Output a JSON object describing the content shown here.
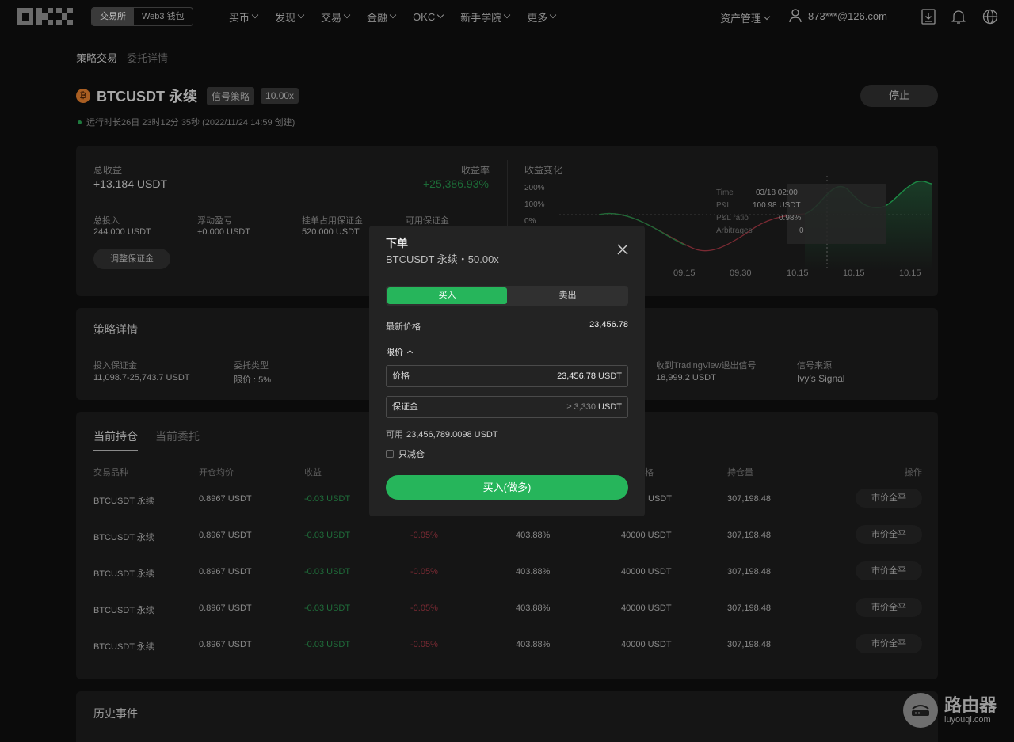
{
  "nav": {
    "logo": "OKX",
    "seg": [
      "交易所",
      "Web3 钱包"
    ],
    "menu": [
      "买币",
      "发现",
      "交易",
      "金融",
      "OKC",
      "新手学院",
      "更多"
    ],
    "asset": "资产管理",
    "user": "873***@126.com"
  },
  "breadcrumb": {
    "a": "策略交易",
    "b": "委托详情"
  },
  "title": {
    "coin": "₿",
    "pair": "BTCUSDT 永续",
    "tag1": "信号策略",
    "tag2": "10.00x",
    "runtime": "运行时长26日 23时12分 35秒 (2022/11/24 14:59 创建)",
    "stop": "停止"
  },
  "summary": {
    "total_label": "总收益",
    "total_value": "+13.184 USDT",
    "rate_label": "收益率",
    "rate_value": "+25,386.93%",
    "stats": [
      {
        "label": "总投入",
        "value": "244.000 USDT"
      },
      {
        "label": "浮动盈亏",
        "value": "+0.000 USDT"
      },
      {
        "label": "挂单占用保证金",
        "value": "520.000 USDT"
      },
      {
        "label": "可用保证金",
        "value": ""
      }
    ],
    "adjust": "调整保证金",
    "chart_title": "收益变化",
    "y_ticks": [
      "200%",
      "100%",
      "0%"
    ],
    "x_ticks": [
      "09.15",
      "09.30",
      "10.15",
      "10.15",
      "10.15"
    ],
    "tooltip": [
      {
        "k": "Time",
        "v": "03/18 02:00"
      },
      {
        "k": "P&L",
        "v": "100.98 USDT"
      },
      {
        "k": "P&L ratio",
        "v": "0.98%"
      },
      {
        "k": "Arbitrages",
        "v": "0"
      }
    ]
  },
  "details": {
    "title": "策略详情",
    "items": [
      {
        "label": "投入保证金",
        "value": "11,098.7-25,743.7 USDT"
      },
      {
        "label": "委托类型",
        "value": "限价 : 5%"
      },
      {
        "label": "收到TradingView退出信号",
        "value": "18,999.2 USDT"
      },
      {
        "label": "信号来源",
        "value": "Ivy’s Signal"
      }
    ]
  },
  "positions": {
    "tabs": [
      "当前持仓",
      "当前委托"
    ],
    "headers": [
      "交易品种",
      "开仓均价",
      "收益",
      "格",
      "持仓量",
      "操作"
    ],
    "rows": [
      {
        "pair": "BTCUSDT 永续",
        "avg": "0.8967 USDT",
        "pnl": "-0.03 USDT",
        "rate": "",
        "c5": "",
        "c6": "USDT",
        "qty": "307,198.48",
        "action": "市价全平"
      },
      {
        "pair": "BTCUSDT 永续",
        "avg": "0.8967 USDT",
        "pnl": "-0.03 USDT",
        "rate": "-0.05%",
        "c5": "403.88%",
        "c6": "40000 USDT",
        "qty": "307,198.48",
        "action": "市价全平"
      },
      {
        "pair": "BTCUSDT 永续",
        "avg": "0.8967 USDT",
        "pnl": "-0.03 USDT",
        "rate": "-0.05%",
        "c5": "403.88%",
        "c6": "40000 USDT",
        "qty": "307,198.48",
        "action": "市价全平"
      },
      {
        "pair": "BTCUSDT 永续",
        "avg": "0.8967 USDT",
        "pnl": "-0.03 USDT",
        "rate": "-0.05%",
        "c5": "403.88%",
        "c6": "40000 USDT",
        "qty": "307,198.48",
        "action": "市价全平"
      },
      {
        "pair": "BTCUSDT 永续",
        "avg": "0.8967 USDT",
        "pnl": "-0.03 USDT",
        "rate": "-0.05%",
        "c5": "403.88%",
        "c6": "40000 USDT",
        "qty": "307,198.48",
        "action": "市价全平"
      }
    ]
  },
  "history": {
    "title": "历史事件"
  },
  "modal": {
    "title": "下单",
    "subtitle": "BTCUSDT 永续・50.00x",
    "buy": "买入",
    "sell": "卖出",
    "last_label": "最新价格",
    "last_value": "23,456.78",
    "limit": "限价",
    "price_label": "价格",
    "price_value": "23,456.78",
    "price_unit": "USDT",
    "margin_label": "保证金",
    "margin_placeholder": "≥ 3,330",
    "margin_unit": "USDT",
    "avail_label": "可用",
    "avail_value": "23,456,789.0098 USDT",
    "reduce_only": "只减仓",
    "submit": "买入(做多)"
  },
  "watermark": {
    "t1": "路由器",
    "t2": "luyouqi.com"
  },
  "colors": {
    "buy": "#26b55b",
    "profit": "#1c6b37",
    "loss": "#7a2a33"
  }
}
